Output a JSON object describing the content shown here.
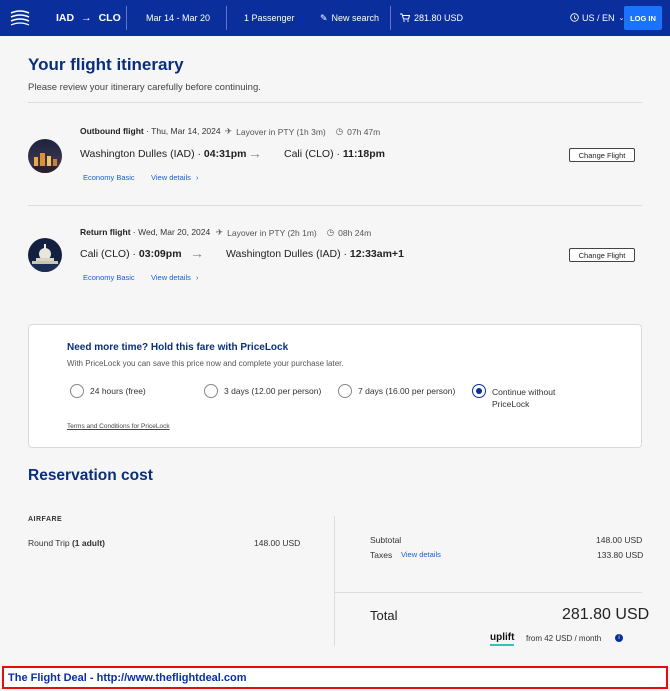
{
  "header": {
    "origin": "IAD",
    "destination": "CLO",
    "dates": "Mar 14 - Mar 20",
    "passengers": "1 Passenger",
    "new_search": "New search",
    "cart_total": "281.80 USD",
    "locale": "US / EN",
    "login": "LOG IN"
  },
  "page": {
    "title": "Your flight itinerary",
    "subtitle": "Please review your itinerary carefully before continuing."
  },
  "outbound": {
    "label": "Outbound flight",
    "date": "· Thu, Mar 14, 2024",
    "layover": "Layover in PTY (1h 3m)",
    "duration": "07h 47m",
    "from": "Washington Dulles (IAD) · ",
    "dep_time": "04:31pm",
    "to": "Cali (CLO) · ",
    "arr_time": "11:18pm",
    "fare": "Economy Basic",
    "details": "View details",
    "change": "Change Flight"
  },
  "return": {
    "label": "Return flight",
    "date": "· Wed, Mar 20, 2024",
    "layover": "Layover in PTY (2h 1m)",
    "duration": "08h 24m",
    "from": "Cali (CLO) · ",
    "dep_time": "03:09pm",
    "to": "Washington Dulles (IAD) · ",
    "arr_time": "12:33am+1",
    "fare": "Economy Basic",
    "details": "View details",
    "change": "Change Flight"
  },
  "pricelock": {
    "title": "Need more time? Hold this fare with PriceLock",
    "subtitle": "With PriceLock you can save this price now and complete your purchase later.",
    "options": [
      {
        "label": "24 hours (free)",
        "selected": false
      },
      {
        "label": "3 days (12.00 per person)",
        "selected": false
      },
      {
        "label": "7 days (16.00 per person)",
        "selected": false
      },
      {
        "label": "Continue without",
        "label2": "PriceLock",
        "selected": true
      }
    ],
    "terms": "Terms and Conditions for PriceLock"
  },
  "reservation": {
    "title": "Reservation cost",
    "airfare_caption": "AIRFARE",
    "trip_label": "Round Trip ",
    "trip_pax": "(1 adult)",
    "trip_amount": "148.00 USD",
    "subtotal_label": "Subtotal",
    "subtotal_value": "148.00 USD",
    "taxes_label": "Taxes",
    "taxes_link": "View details",
    "taxes_value": "133.80 USD",
    "total_label": "Total",
    "total_value": "281.80 USD",
    "uplift_brand": "uplift",
    "uplift_text": "from 42 USD / month"
  },
  "banner": {
    "text": "The Flight Deal - http://www.theflightdeal.com"
  },
  "colors": {
    "header_bg": "#0a2f9c",
    "accent": "#0a2f7a",
    "link": "#1a5fd8",
    "banner_border": "#e01010"
  }
}
